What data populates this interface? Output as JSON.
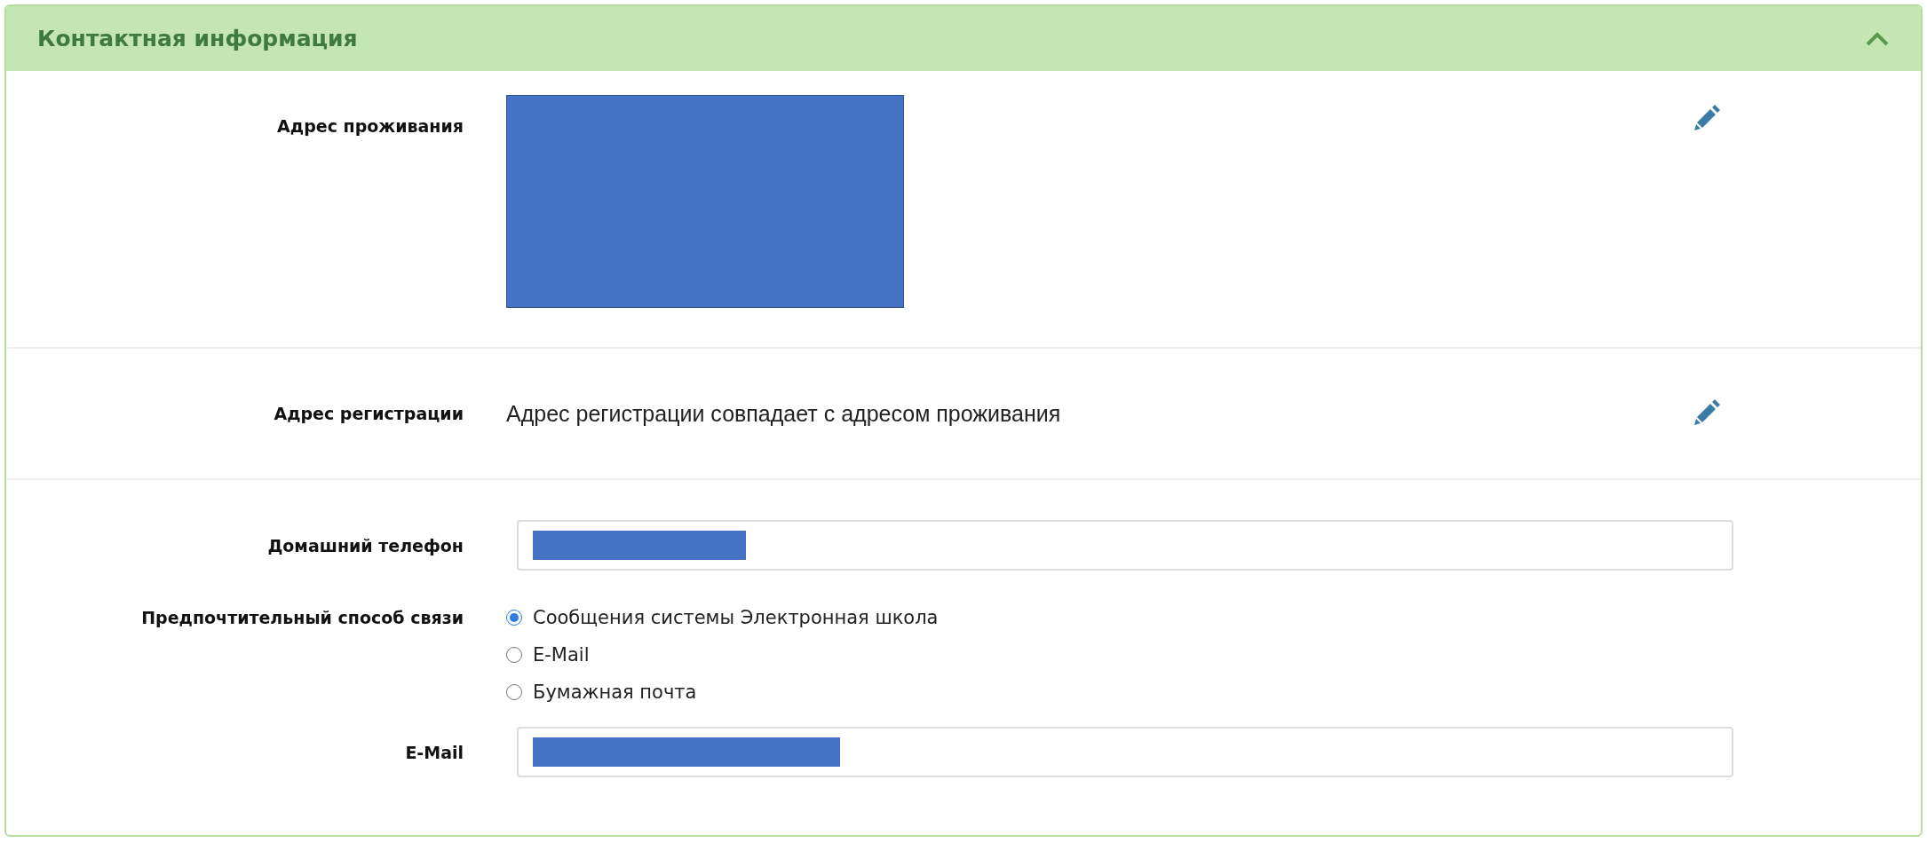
{
  "panel": {
    "title": "Контактная информация",
    "expanded": true
  },
  "rows": [
    {
      "kind": "redacted",
      "label": "Адрес проживания",
      "editable": true
    },
    {
      "kind": "text",
      "label": "Адрес регистрации",
      "value": "Адрес регистрации совпадает с адресом проживания",
      "editable": true
    },
    {
      "kind": "input",
      "label": "Домашний телефон"
    },
    {
      "kind": "radio",
      "label": "Предпочтительный способ связи",
      "options": [
        {
          "label": "Сообщения системы Электронная школа",
          "selected": true
        },
        {
          "label": "E-Mail",
          "selected": false
        },
        {
          "label": "Бумажная почта",
          "selected": false
        }
      ]
    },
    {
      "kind": "input",
      "label": "E-Mail"
    }
  ]
}
